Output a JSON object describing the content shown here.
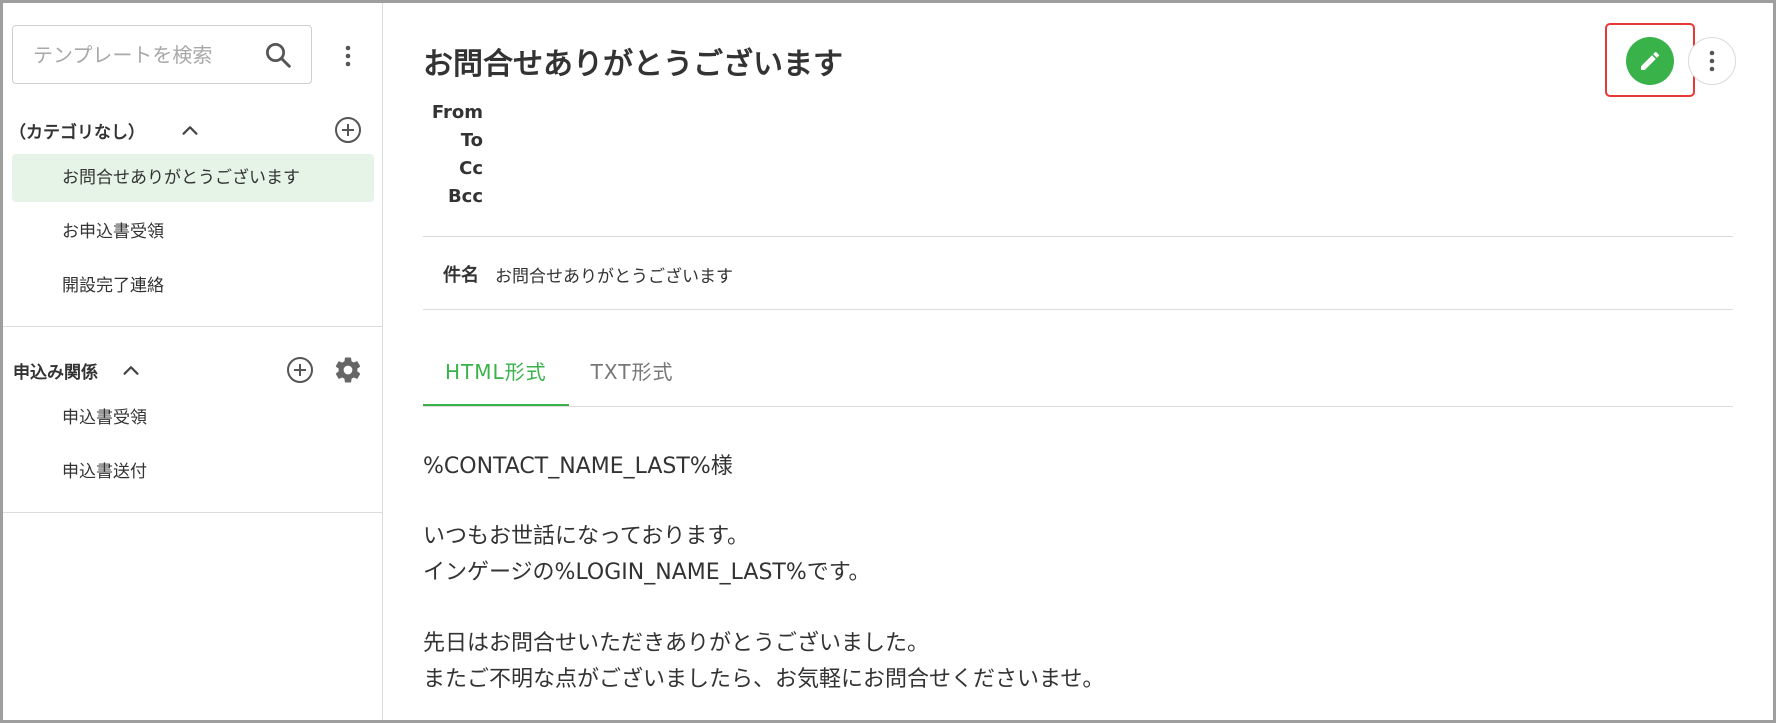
{
  "sidebar": {
    "search_placeholder": "テンプレートを検索",
    "categories": [
      {
        "title": "（カテゴリなし）",
        "items": [
          {
            "label": "お問合せありがとうございます",
            "active": true
          },
          {
            "label": "お申込書受領",
            "active": false
          },
          {
            "label": "開設完了連絡",
            "active": false
          }
        ]
      },
      {
        "title": "申込み関係",
        "items": [
          {
            "label": "申込書受領",
            "active": false
          },
          {
            "label": "申込書送付",
            "active": false
          }
        ]
      }
    ]
  },
  "main": {
    "title": "お問合せありがとうございます",
    "headers": {
      "from_label": "From",
      "from_value": "",
      "to_label": "To",
      "to_value": "",
      "cc_label": "Cc",
      "cc_value": "",
      "bcc_label": "Bcc",
      "bcc_value": ""
    },
    "subject_label": "件名",
    "subject_value": "お問合せありがとうございます",
    "tabs": [
      {
        "label": "HTML形式",
        "active": true
      },
      {
        "label": "TXT形式",
        "active": false
      }
    ],
    "body_lines": [
      "%CONTACT_NAME_LAST%様",
      "いつもお世話になっております。",
      "インゲージの%LOGIN_NAME_LAST%です。",
      "先日はお問合せいただきありがとうございました。",
      "またご不明な点がございましたら、お気軽にお問合せくださいませ。"
    ]
  },
  "colors": {
    "accent": "#3ab24a",
    "active_item_bg": "#e6f4e8",
    "highlight": "#e53935"
  },
  "icons": {
    "search": "search-icon",
    "kebab": "kebab-menu-icon",
    "chevron": "chevron-up-icon",
    "add": "add-circle-icon",
    "gear": "gear-icon",
    "edit": "pencil-icon"
  }
}
